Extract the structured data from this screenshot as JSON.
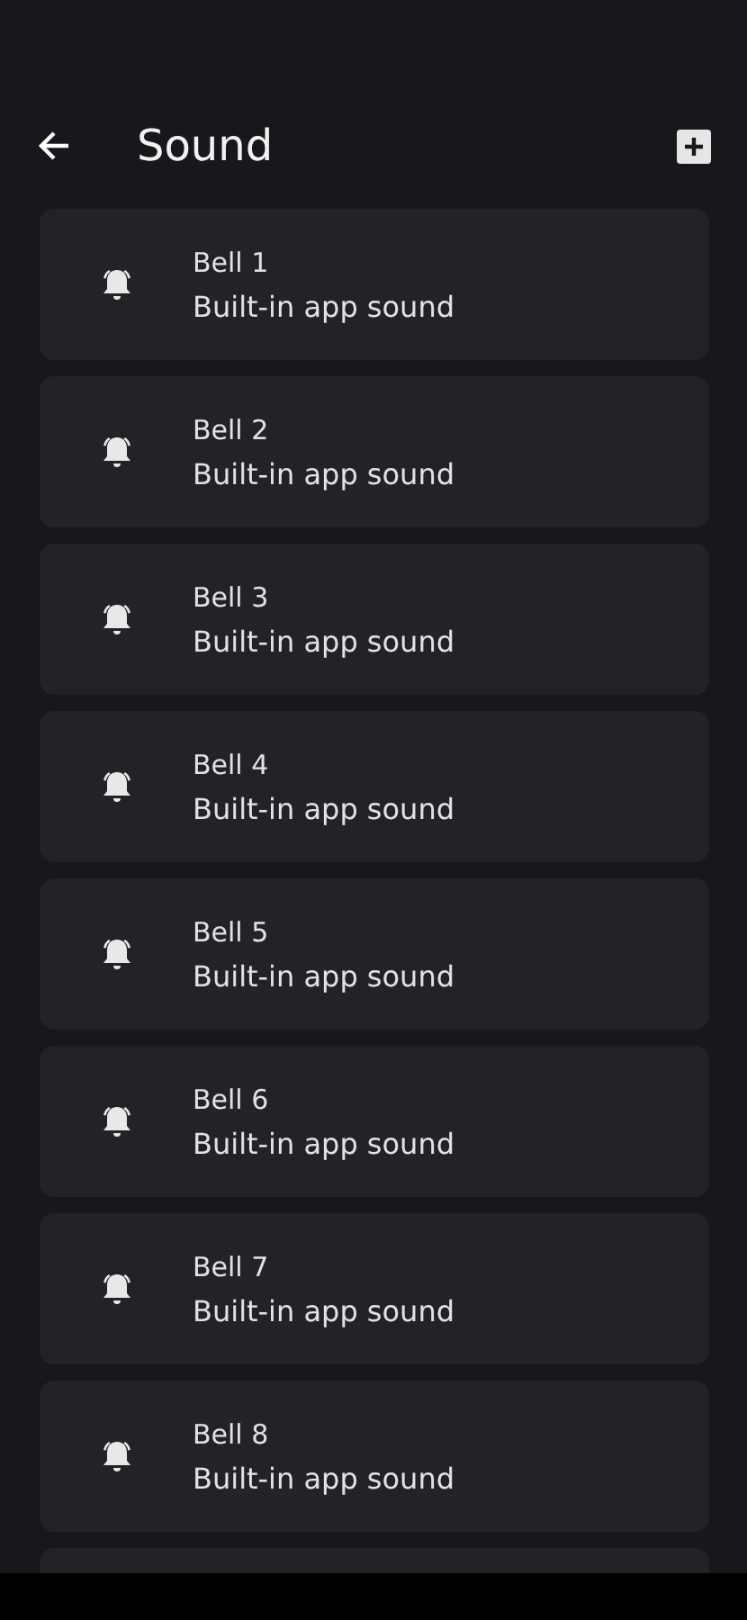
{
  "header": {
    "title": "Sound"
  },
  "sounds": [
    {
      "name": "Bell 1",
      "description": "Built-in app sound"
    },
    {
      "name": "Bell 2",
      "description": "Built-in app sound"
    },
    {
      "name": "Bell 3",
      "description": "Built-in app sound"
    },
    {
      "name": "Bell 4",
      "description": "Built-in app sound"
    },
    {
      "name": "Bell 5",
      "description": "Built-in app sound"
    },
    {
      "name": "Bell 6",
      "description": "Built-in app sound"
    },
    {
      "name": "Bell 7",
      "description": "Built-in app sound"
    },
    {
      "name": "Bell 8",
      "description": "Built-in app sound"
    }
  ]
}
